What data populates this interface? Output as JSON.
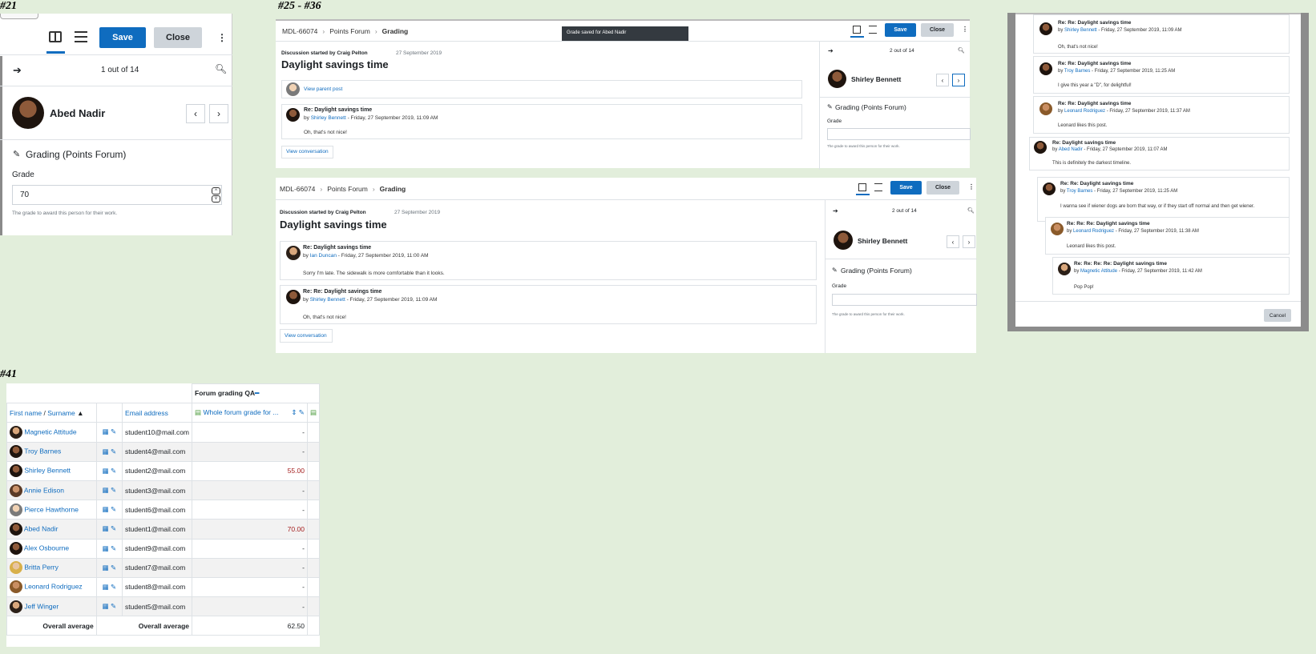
{
  "labels": {
    "s21": "#21",
    "s25": "#25 - #36",
    "s41": "#41"
  },
  "grader21": {
    "save": "Save",
    "close": "Close",
    "count": "1 out of 14",
    "user": "Abed Nadir",
    "grading_title": "Grading (Points Forum)",
    "grade_label": "Grade",
    "grade_value": "70",
    "help": "The grade to award this person for their work."
  },
  "grader_a": {
    "crumbs": [
      "MDL-66074",
      "Points Forum",
      "Grading"
    ],
    "toast": "Grade saved for Abed Nadir",
    "save": "Save",
    "close": "Close",
    "started_by": "Discussion started by Craig Pelton",
    "started_date": "27 September 2019",
    "title": "Daylight savings time",
    "parent_link": "View parent post",
    "post": {
      "title": "Re: Daylight savings time",
      "by": "by",
      "author": "Shirley Bennett",
      "date": " - Friday, 27 September 2019, 11:09 AM",
      "body": "Oh, that's not nice!"
    },
    "view_conv": "View conversation",
    "count": "2 out of 14",
    "user": "Shirley Bennett",
    "grading_title": "Grading (Points Forum)",
    "grade_label": "Grade",
    "help": "The grade to award this person for their work."
  },
  "grader_b": {
    "crumbs": [
      "MDL-66074",
      "Points Forum",
      "Grading"
    ],
    "save": "Save",
    "close": "Close",
    "started_by": "Discussion started by Craig Pelton",
    "started_date": "27 September 2019",
    "title": "Daylight savings time",
    "posts": [
      {
        "title": "Re: Daylight savings time",
        "by": "by",
        "author": "Ian Duncan",
        "date": " - Friday, 27 September 2019, 11:00 AM",
        "body": "Sorry I'm late. The sidewalk is more comfortable than it looks."
      },
      {
        "title": "Re: Re: Daylight savings time",
        "by": "by",
        "author": "Shirley Bennett",
        "date": " - Friday, 27 September 2019, 11:09 AM",
        "body": "Oh, that's not nice!"
      }
    ],
    "view_conv": "View conversation",
    "count": "2 out of 14",
    "user": "Shirley Bennett",
    "grading_title": "Grading (Points Forum)",
    "grade_label": "Grade",
    "help": "The grade to award this person for their work."
  },
  "conversation": {
    "posts": [
      {
        "title": "Re: Re: Daylight savings time",
        "by": "by",
        "author": "Shirley Bennett",
        "date": " - Friday, 27 September 2019, 11:09 AM",
        "body": "Oh, that's not nice!"
      },
      {
        "title": "Re: Re: Daylight savings time",
        "by": "by",
        "author": "Troy Barnes",
        "date": " - Friday, 27 September 2019, 11:25 AM",
        "body": "I give this year a \"D\", for delightful!"
      },
      {
        "title": "Re: Re: Daylight savings time",
        "by": "by",
        "author": "Leonard Rodriguez",
        "date": " - Friday, 27 September 2019, 11:37 AM",
        "body": "Leonard likes this post."
      },
      {
        "title": "Re: Daylight savings time",
        "by": "by",
        "author": "Abed Nadir",
        "date": " - Friday, 27 September 2019, 11:07 AM",
        "body": "This is definitely the darkest timeline."
      },
      {
        "title": "Re: Re: Daylight savings time",
        "by": "by",
        "author": "Troy Barnes",
        "date": " - Friday, 27 September 2019, 11:25 AM",
        "body": "I wanna see if wiener dogs are born that way, or if they start off normal and then get wiener."
      },
      {
        "title": "Re: Re: Re: Daylight savings time",
        "by": "by",
        "author": "Leonard Rodriguez",
        "date": " - Friday, 27 September 2019, 11:38 AM",
        "body": "Leonard likes this post."
      },
      {
        "title": "Re: Re: Re: Re: Daylight savings time",
        "by": "by",
        "author": "Magnetic Attitude",
        "date": " - Friday, 27 September 2019, 11:42 AM",
        "body": "Pop Pop!"
      }
    ],
    "cancel": "Cancel"
  },
  "gradebook": {
    "category": "Forum grading QA",
    "col_first": "First name",
    "col_slash": " / ",
    "col_surname": "Surname",
    "col_email": "Email address",
    "col_item": "Whole forum grade for ...",
    "rows": [
      {
        "name": "Magnetic Attitude",
        "email": "student10@mail.com",
        "grade": "-"
      },
      {
        "name": "Troy Barnes",
        "email": "student4@mail.com",
        "grade": "-"
      },
      {
        "name": "Shirley Bennett",
        "email": "student2@mail.com",
        "grade": "55.00"
      },
      {
        "name": "Annie Edison",
        "email": "student3@mail.com",
        "grade": "-"
      },
      {
        "name": "Pierce Hawthorne",
        "email": "student6@mail.com",
        "grade": "-"
      },
      {
        "name": "Abed Nadir",
        "email": "student1@mail.com",
        "grade": "70.00"
      },
      {
        "name": "Alex Osbourne",
        "email": "student9@mail.com",
        "grade": "-"
      },
      {
        "name": "Britta Perry",
        "email": "student7@mail.com",
        "grade": "-"
      },
      {
        "name": "Leonard Rodriguez",
        "email": "student8@mail.com",
        "grade": "-"
      },
      {
        "name": "Jeff Winger",
        "email": "student5@mail.com",
        "grade": "-"
      }
    ],
    "avg_label": "Overall average",
    "avg_label2": "Overall average",
    "avg_value": "62.50"
  },
  "colors": {
    "accent": "#0f6cbf",
    "grade_red": "#a41e1e",
    "background": "#e2eedb"
  }
}
